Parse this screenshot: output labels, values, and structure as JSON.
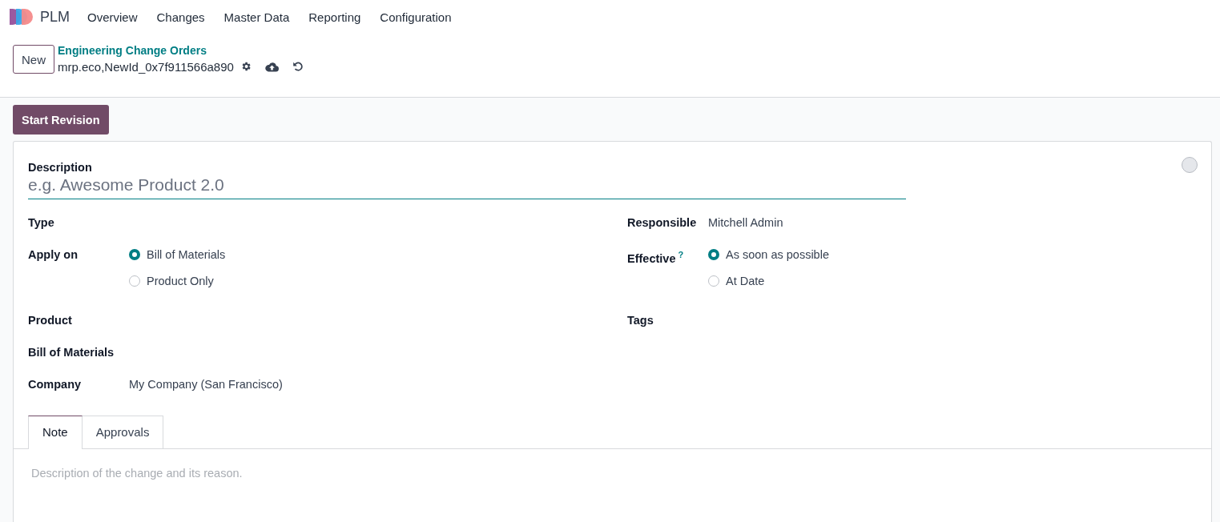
{
  "navbar": {
    "app_name": "PLM",
    "menu": [
      "Overview",
      "Changes",
      "Master Data",
      "Reporting",
      "Configuration"
    ]
  },
  "control_panel": {
    "new_button": "New",
    "breadcrumb": "Engineering Change Orders",
    "record_name": "mrp.eco,NewId_0x7f911566a890"
  },
  "status_buttons": [
    "Start Revision"
  ],
  "form": {
    "description": {
      "label": "Description",
      "placeholder": "e.g. Awesome Product 2.0"
    },
    "left_fields": [
      {
        "label": "Type"
      },
      {
        "label": "Apply on",
        "options": [
          {
            "label": "Bill of Materials",
            "selected": true
          },
          {
            "label": "Product Only",
            "selected": false
          }
        ]
      },
      {
        "label": "Product"
      },
      {
        "label": "Bill of Materials"
      },
      {
        "label": "Company",
        "value": "My Company (San Francisco)"
      }
    ],
    "right_fields": [
      {
        "label": "Responsible",
        "value": "Mitchell Admin"
      },
      {
        "label": "Effective",
        "help": "?",
        "options": [
          {
            "label": "As soon as possible",
            "selected": true
          },
          {
            "label": "At Date",
            "selected": false
          }
        ]
      },
      {
        "label": "Tags"
      }
    ]
  },
  "tabs": [
    {
      "label": "Note",
      "selected": true
    },
    {
      "label": "Approvals",
      "selected": false
    }
  ],
  "note": {
    "placeholder": "Description of the change and its reason."
  }
}
